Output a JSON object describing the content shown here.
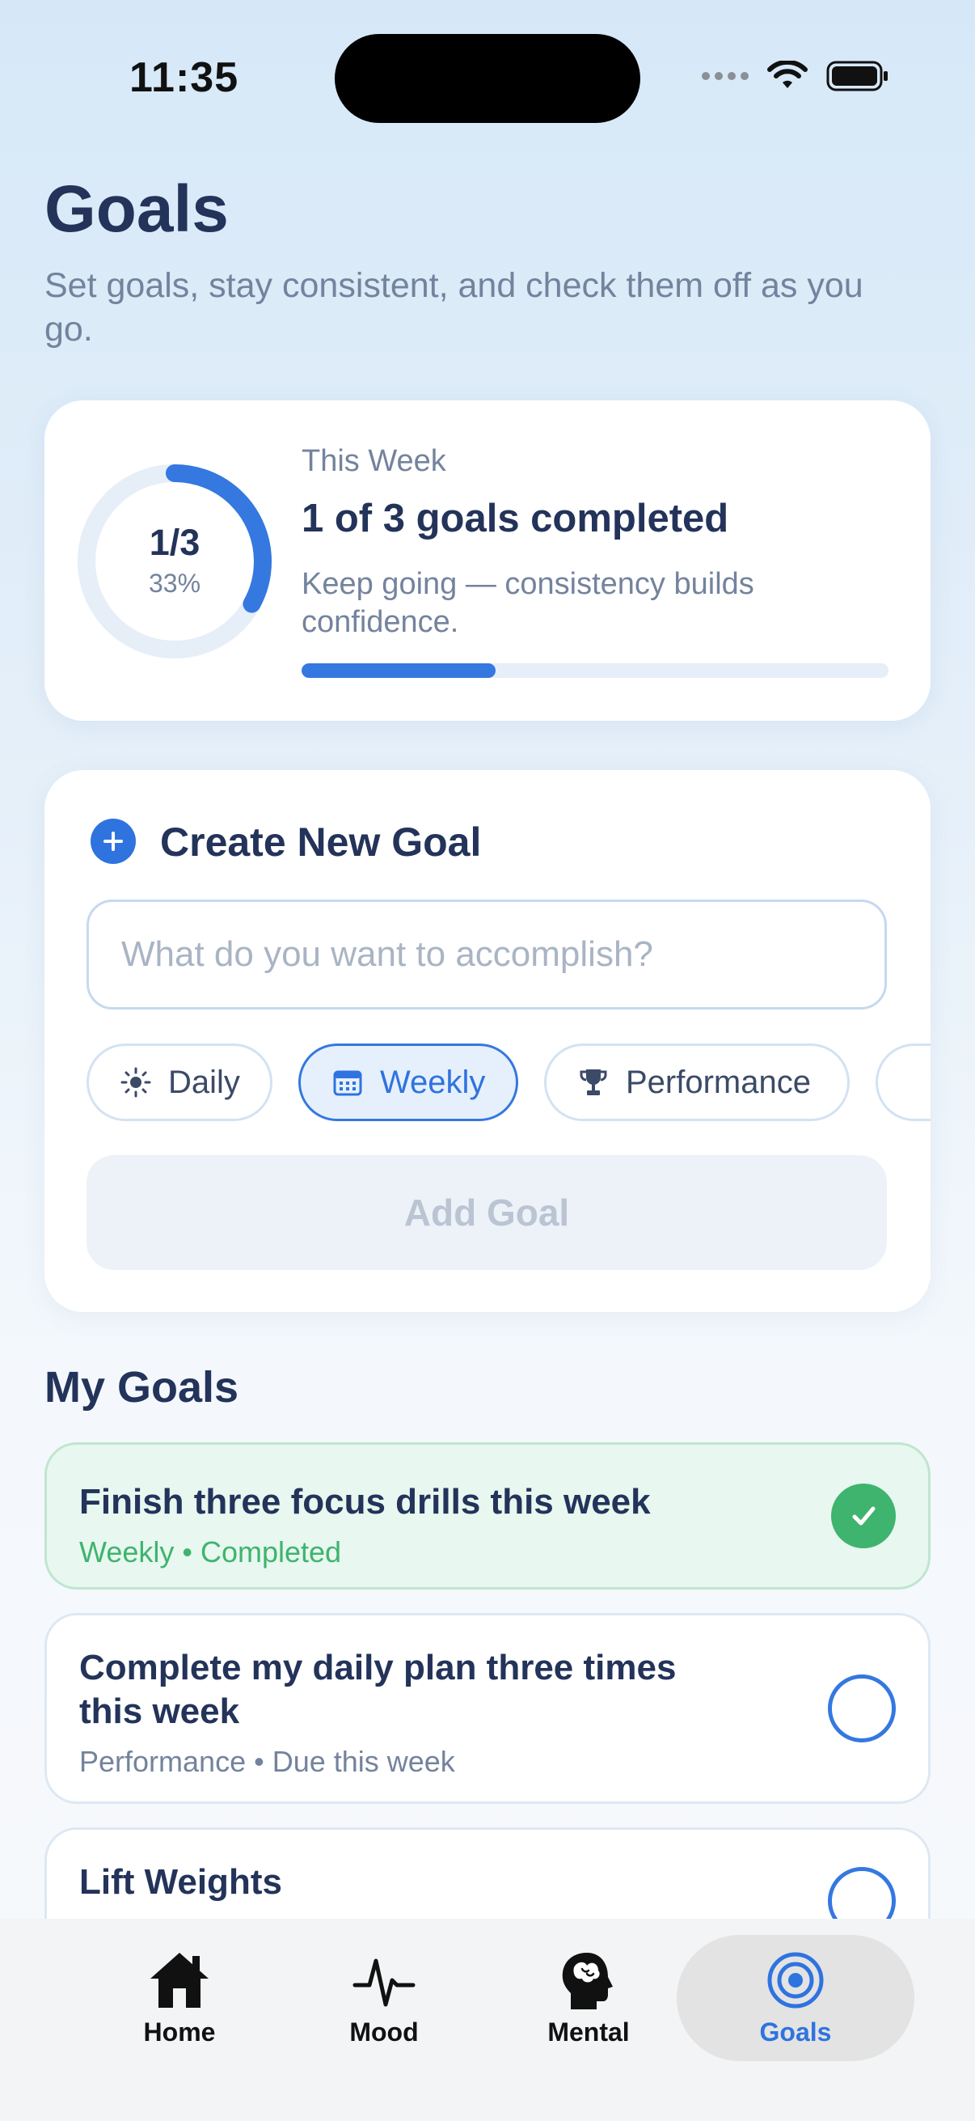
{
  "status_bar": {
    "time": "11:35"
  },
  "header": {
    "title": "Goals",
    "subtitle": "Set goals, stay consistent, and check them off as you go."
  },
  "progress": {
    "fraction": "1/3",
    "percent": "33%",
    "progress_value": 0.33,
    "label": "This Week",
    "headline": "1 of 3 goals completed",
    "message": "Keep going — consistency builds confidence."
  },
  "create_goal": {
    "title": "Create New Goal",
    "placeholder": "What do you want to accomplish?",
    "categories": [
      {
        "label": "Daily",
        "icon": "sun-icon",
        "selected": false
      },
      {
        "label": "Weekly",
        "icon": "calendar-icon",
        "selected": true
      },
      {
        "label": "Performance",
        "icon": "trophy-icon",
        "selected": false
      }
    ],
    "add_button": "Add Goal"
  },
  "my_goals": {
    "title": "My Goals",
    "items": [
      {
        "title": "Finish three focus drills this week",
        "category": "Weekly",
        "status": "Completed",
        "completed": true
      },
      {
        "title": "Complete my daily plan three times this week",
        "category": "Performance",
        "status": "Due this week",
        "completed": false
      },
      {
        "title": "Lift Weights",
        "category": "",
        "status": "",
        "completed": false
      }
    ]
  },
  "tabs": [
    {
      "label": "Home",
      "icon": "home-icon",
      "active": false
    },
    {
      "label": "Mood",
      "icon": "pulse-icon",
      "active": false
    },
    {
      "label": "Mental",
      "icon": "brain-head-icon",
      "active": false
    },
    {
      "label": "Goals",
      "icon": "target-icon",
      "active": true
    }
  ],
  "colors": {
    "accent": "#3478e0",
    "success": "#3eb46e",
    "text_primary": "#23335a",
    "text_secondary": "#74839d"
  }
}
